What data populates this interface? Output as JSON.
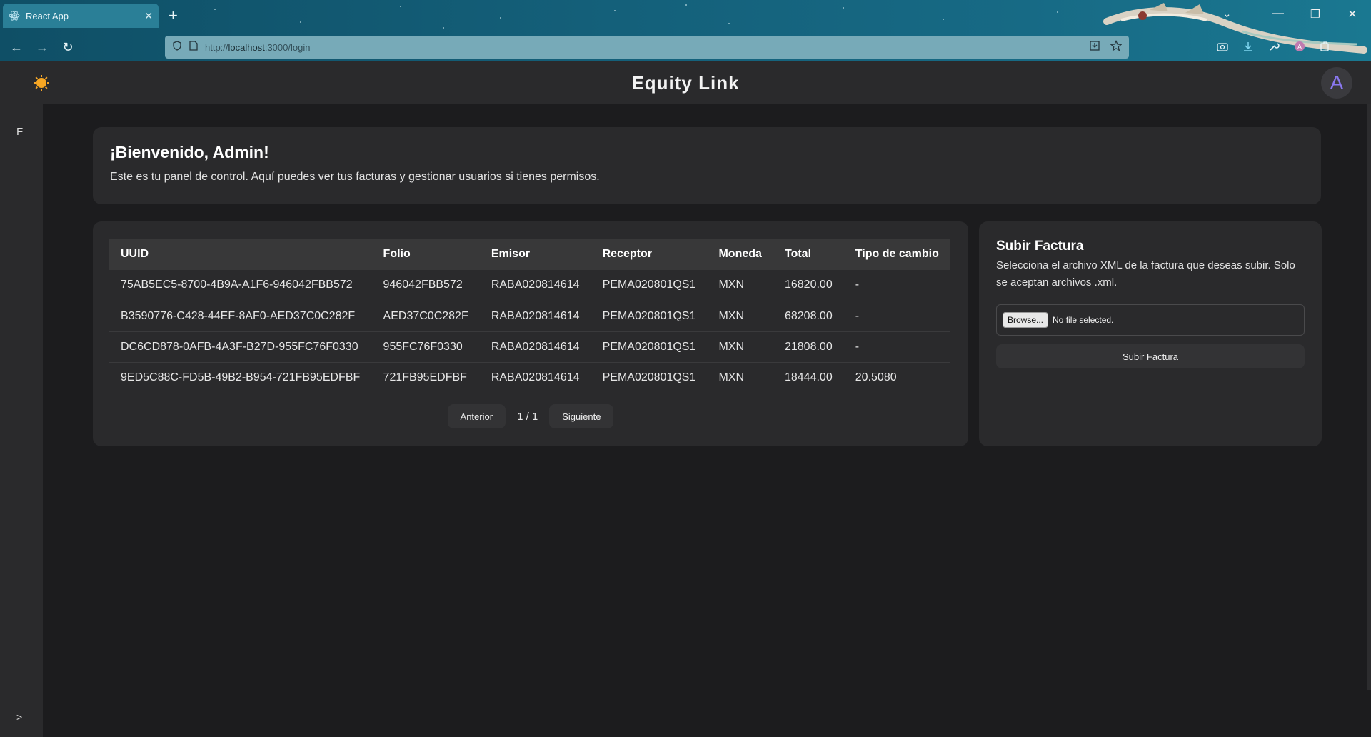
{
  "browser": {
    "tab_title": "React App",
    "tab_close": "✕",
    "new_tab": "+",
    "url_prefix": "http://",
    "url_host": "localhost",
    "url_path": ":3000/login",
    "back": "←",
    "forward": "→",
    "reload": "↻",
    "window": {
      "list": "⌄",
      "minimize": "—",
      "restore": "❐",
      "close": "✕"
    }
  },
  "header": {
    "title": "Equity Link",
    "avatar_initial": "A",
    "accent_color": "#8a78f0"
  },
  "sidebar": {
    "item_label": "F",
    "expand_label": ">"
  },
  "welcome": {
    "heading": "¡Bienvenido, Admin!",
    "text": "Este es tu panel de control. Aquí puedes ver tus facturas y gestionar usuarios si tienes permisos."
  },
  "invoices": {
    "columns": [
      "UUID",
      "Folio",
      "Emisor",
      "Receptor",
      "Moneda",
      "Total",
      "Tipo de cambio"
    ],
    "rows": [
      [
        "75AB5EC5-8700-4B9A-A1F6-946042FBB572",
        "946042FBB572",
        "RABA020814614",
        "PEMA020801QS1",
        "MXN",
        "16820.00",
        "-"
      ],
      [
        "B3590776-C428-44EF-8AF0-AED37C0C282F",
        "AED37C0C282F",
        "RABA020814614",
        "PEMA020801QS1",
        "MXN",
        "68208.00",
        "-"
      ],
      [
        "DC6CD878-0AFB-4A3F-B27D-955FC76F0330",
        "955FC76F0330",
        "RABA020814614",
        "PEMA020801QS1",
        "MXN",
        "21808.00",
        "-"
      ],
      [
        "9ED5C88C-FD5B-49B2-B954-721FB95EDFBF",
        "721FB95EDFBF",
        "RABA020814614",
        "PEMA020801QS1",
        "MXN",
        "18444.00",
        "20.5080"
      ]
    ],
    "pager": {
      "prev": "Anterior",
      "indicator": "1 / 1",
      "next": "Siguiente"
    }
  },
  "upload": {
    "title": "Subir Factura",
    "description": "Selecciona el archivo XML de la factura que deseas subir. Solo se aceptan archivos .xml.",
    "browse_label": "Browse...",
    "no_file_label": "No file selected.",
    "submit_label": "Subir Factura"
  }
}
